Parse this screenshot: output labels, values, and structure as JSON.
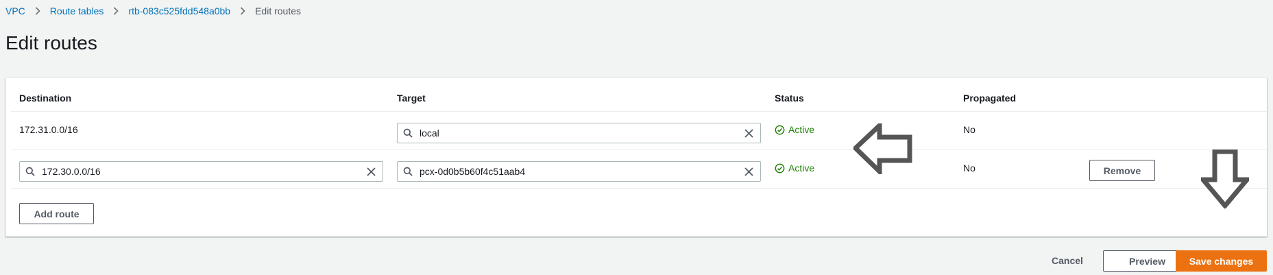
{
  "breadcrumb": {
    "items": [
      "VPC",
      "Route tables",
      "rtb-083c525fdd548a0bb"
    ],
    "current": "Edit routes"
  },
  "page": {
    "title": "Edit routes"
  },
  "table": {
    "columns": [
      "Destination",
      "Target",
      "Status",
      "Propagated"
    ],
    "rows": [
      {
        "destination": "172.31.0.0/16",
        "target": "local",
        "status": "Active",
        "propagated": "No"
      },
      {
        "destination": "172.30.0.0/16",
        "target": "pcx-0d0b5b60f4c51aab4",
        "status": "Active",
        "propagated": "No",
        "remove_label": "Remove"
      }
    ],
    "add_route_label": "Add route"
  },
  "footer": {
    "cancel_label": "Cancel",
    "preview_label": "Preview",
    "save_label": "Save changes"
  },
  "colors": {
    "link": "#0073bb",
    "success": "#1d8102",
    "primary": "#ec7211",
    "annotation_arrow": "#555555"
  },
  "icons": [
    "chevron-right-icon",
    "search-icon",
    "close-icon",
    "status-success-icon",
    "arrow-left-icon",
    "arrow-down-icon"
  ]
}
